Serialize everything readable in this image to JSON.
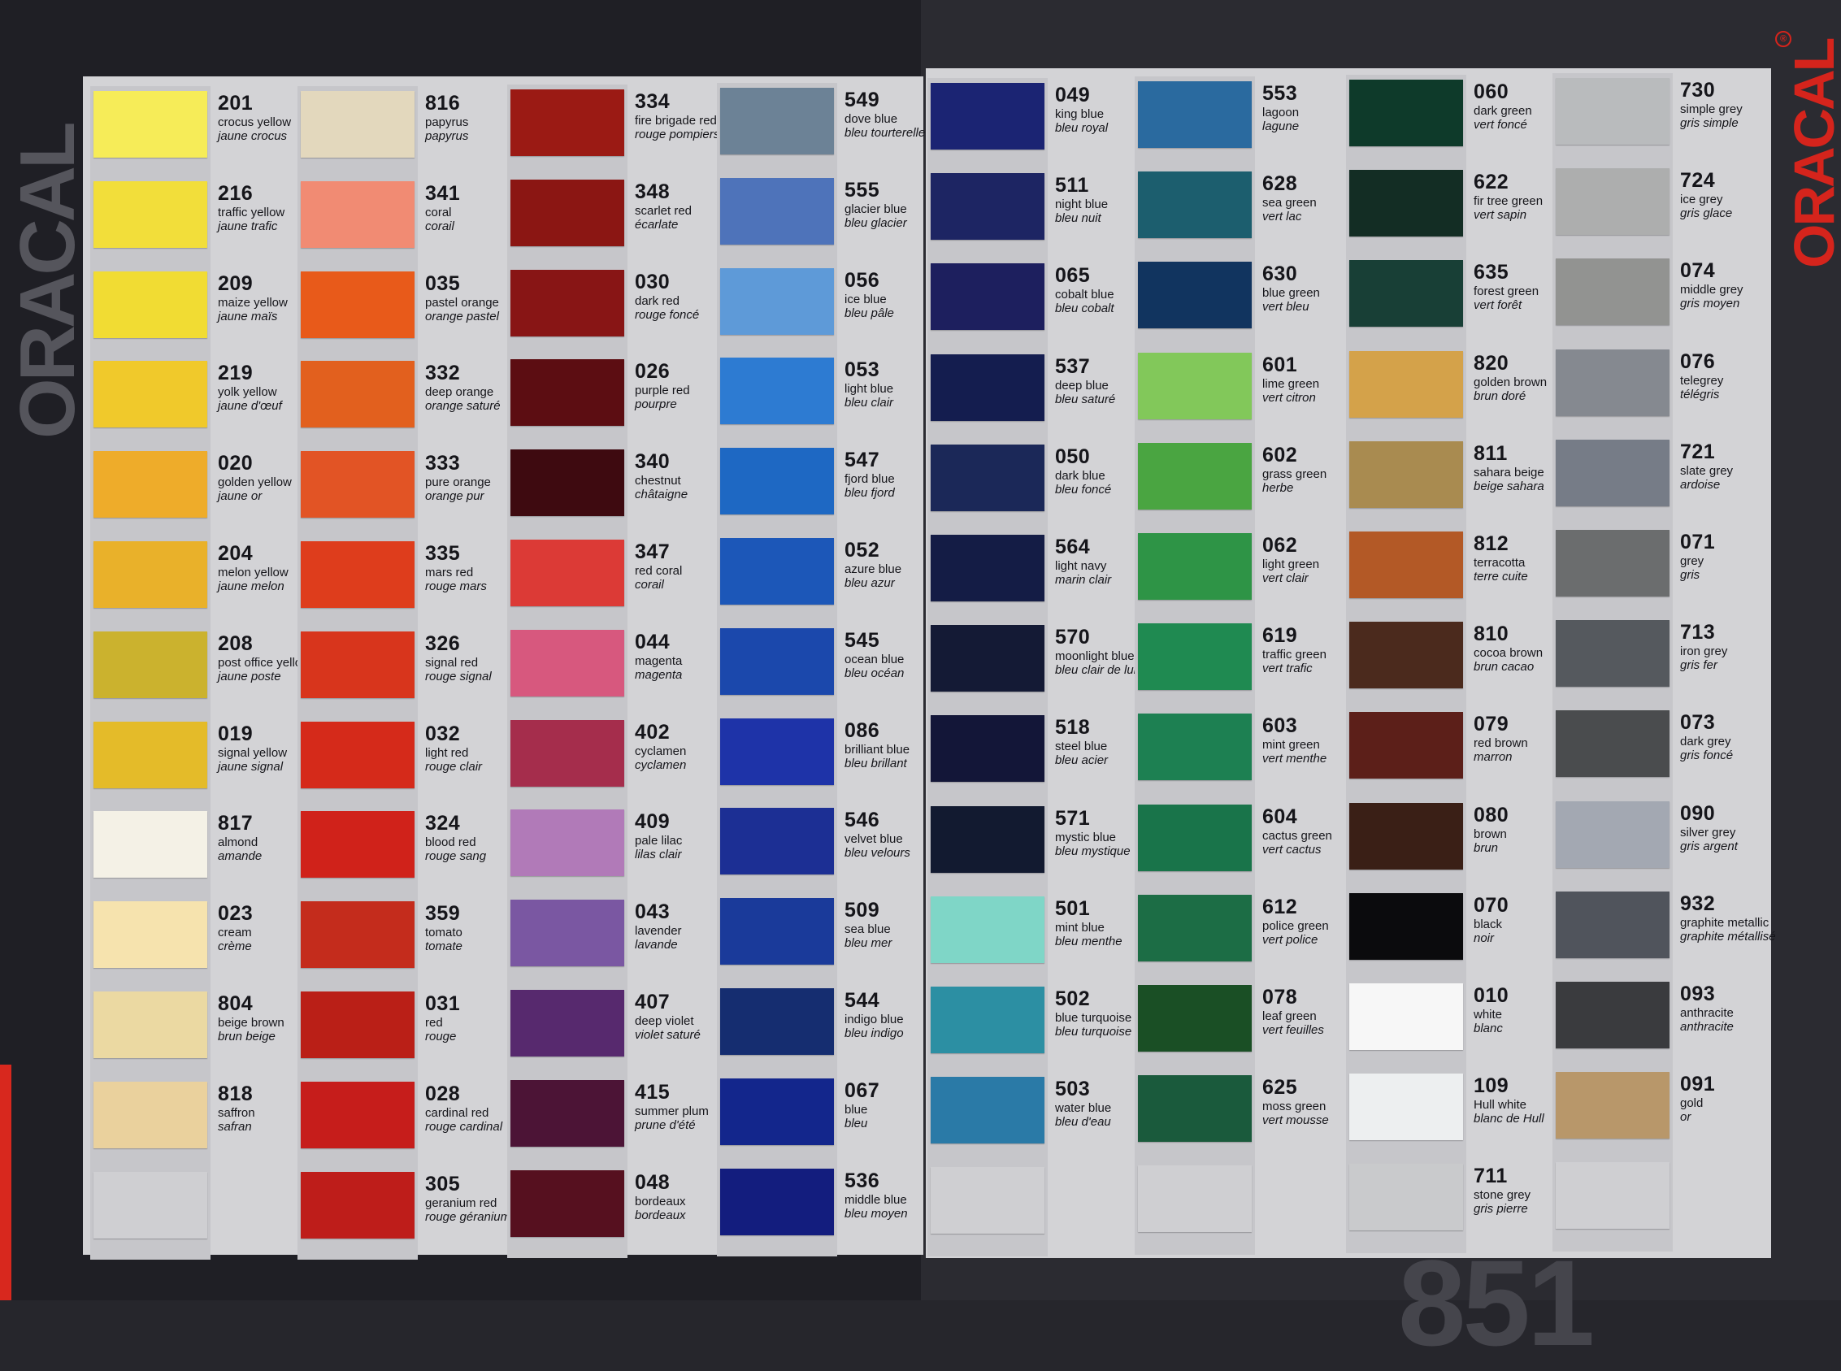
{
  "brand": {
    "left_logo": "ORACAL",
    "right_logo": "ORACAL",
    "registered_mark": "®",
    "series_number": "851"
  },
  "columns": [
    {
      "id": "col1",
      "swatches": [
        {
          "code": "201",
          "name_en": "crocus yellow",
          "name_fr": "jaune crocus",
          "color": "#f6ec58"
        },
        {
          "code": "216",
          "name_en": "traffic yellow",
          "name_fr": "jaune trafic",
          "color": "#f2de3a"
        },
        {
          "code": "209",
          "name_en": "maize yellow",
          "name_fr": "jaune maïs",
          "color": "#f1dc33"
        },
        {
          "code": "219",
          "name_en": "yolk yellow",
          "name_fr": "jaune d'œuf",
          "color": "#f0c92b"
        },
        {
          "code": "020",
          "name_en": "golden yellow",
          "name_fr": "jaune or",
          "color": "#eeac2a"
        },
        {
          "code": "204",
          "name_en": "melon yellow",
          "name_fr": "jaune melon",
          "color": "#e9b12a"
        },
        {
          "code": "208",
          "name_en": "post office yellow",
          "name_fr": "jaune poste",
          "color": "#cbb22e"
        },
        {
          "code": "019",
          "name_en": "signal yellow",
          "name_fr": "jaune signal",
          "color": "#e4bb29"
        },
        {
          "code": "817",
          "name_en": "almond",
          "name_fr": "amande",
          "color": "#f4f1e6"
        },
        {
          "code": "023",
          "name_en": "cream",
          "name_fr": "crème",
          "color": "#f6e3ae"
        },
        {
          "code": "804",
          "name_en": "beige brown",
          "name_fr": "brun beige",
          "color": "#ebd9a2"
        },
        {
          "code": "818",
          "name_en": "saffron",
          "name_fr": "safran",
          "color": "#ead19d"
        }
      ]
    },
    {
      "id": "col2",
      "swatches": [
        {
          "code": "816",
          "name_en": "papyrus",
          "name_fr": "papyrus",
          "color": "#e3d8bd"
        },
        {
          "code": "341",
          "name_en": "coral",
          "name_fr": "corail",
          "color": "#f18b73"
        },
        {
          "code": "035",
          "name_en": "pastel orange",
          "name_fr": "orange pastel",
          "color": "#e85a1a"
        },
        {
          "code": "332",
          "name_en": "deep orange",
          "name_fr": "orange saturé",
          "color": "#e2601e"
        },
        {
          "code": "333",
          "name_en": "pure orange",
          "name_fr": "orange pur",
          "color": "#e25425"
        },
        {
          "code": "335",
          "name_en": "mars red",
          "name_fr": "rouge mars",
          "color": "#de3d1c"
        },
        {
          "code": "326",
          "name_en": "signal red",
          "name_fr": "rouge signal",
          "color": "#d8351c"
        },
        {
          "code": "032",
          "name_en": "light red",
          "name_fr": "rouge clair",
          "color": "#d52a1a"
        },
        {
          "code": "324",
          "name_en": "blood red",
          "name_fr": "rouge sang",
          "color": "#d0221a"
        },
        {
          "code": "359",
          "name_en": "tomato",
          "name_fr": "tomate",
          "color": "#c42c1c"
        },
        {
          "code": "031",
          "name_en": "red",
          "name_fr": "rouge",
          "color": "#ba1f17"
        },
        {
          "code": "028",
          "name_en": "cardinal red",
          "name_fr": "rouge cardinal",
          "color": "#c61d1b"
        },
        {
          "code": "305",
          "name_en": "geranium red",
          "name_fr": "rouge géranium",
          "color": "#be1d1a"
        }
      ]
    },
    {
      "id": "col3",
      "swatches": [
        {
          "code": "334",
          "name_en": "fire brigade red",
          "name_fr": "rouge pompiers",
          "color": "#9b1a14"
        },
        {
          "code": "348",
          "name_en": "scarlet red",
          "name_fr": "écarlate",
          "color": "#8b1613"
        },
        {
          "code": "030",
          "name_en": "dark red",
          "name_fr": "rouge foncé",
          "color": "#881515"
        },
        {
          "code": "026",
          "name_en": "purple red",
          "name_fr": "pourpre",
          "color": "#5c0d12"
        },
        {
          "code": "340",
          "name_en": "chestnut",
          "name_fr": "châtaigne",
          "color": "#3e0a10"
        },
        {
          "code": "347",
          "name_en": "red coral",
          "name_fr": "corail",
          "color": "#dc3a36"
        },
        {
          "code": "044",
          "name_en": "magenta",
          "name_fr": "magenta",
          "color": "#d7587e"
        },
        {
          "code": "402",
          "name_en": "cyclamen",
          "name_fr": "cyclamen",
          "color": "#a52d4c"
        },
        {
          "code": "409",
          "name_en": "pale lilac",
          "name_fr": "lilas clair",
          "color": "#b17ab8"
        },
        {
          "code": "043",
          "name_en": "lavender",
          "name_fr": "lavande",
          "color": "#7a57a2"
        },
        {
          "code": "407",
          "name_en": "deep violet",
          "name_fr": "violet saturé",
          "color": "#57296e"
        },
        {
          "code": "415",
          "name_en": "summer plum",
          "name_fr": "prune d'été",
          "color": "#4c1436"
        },
        {
          "code": "048",
          "name_en": "bordeaux",
          "name_fr": "bordeaux",
          "color": "#56101f"
        }
      ]
    },
    {
      "id": "col4",
      "swatches": [
        {
          "code": "549",
          "name_en": "dove blue",
          "name_fr": "bleu tourterelle",
          "color": "#6c8296"
        },
        {
          "code": "555",
          "name_en": "glacier blue",
          "name_fr": "bleu glacier",
          "color": "#4e73ba"
        },
        {
          "code": "056",
          "name_en": "ice blue",
          "name_fr": "bleu pâle",
          "color": "#5e9ad8"
        },
        {
          "code": "053",
          "name_en": "light blue",
          "name_fr": "bleu clair",
          "color": "#2d7bd2"
        },
        {
          "code": "547",
          "name_en": "fjord blue",
          "name_fr": "bleu fjord",
          "color": "#1e68c3"
        },
        {
          "code": "052",
          "name_en": "azure blue",
          "name_fr": "bleu azur",
          "color": "#1c57b8"
        },
        {
          "code": "545",
          "name_en": "ocean blue",
          "name_fr": "bleu océan",
          "color": "#1b48ac"
        },
        {
          "code": "086",
          "name_en": "brilliant blue",
          "name_fr": "bleu brillant",
          "color": "#1e33a8"
        },
        {
          "code": "546",
          "name_en": "velvet blue",
          "name_fr": "bleu velours",
          "color": "#1c2f94"
        },
        {
          "code": "509",
          "name_en": "sea blue",
          "name_fr": "bleu mer",
          "color": "#1a3a9a"
        },
        {
          "code": "544",
          "name_en": "indigo blue",
          "name_fr": "bleu indigo",
          "color": "#152d70"
        },
        {
          "code": "067",
          "name_en": "blue",
          "name_fr": "bleu",
          "color": "#13268c"
        },
        {
          "code": "536",
          "name_en": "middle blue",
          "name_fr": "bleu moyen",
          "color": "#131d7e"
        }
      ]
    },
    {
      "id": "col5",
      "swatches": [
        {
          "code": "049",
          "name_en": "king blue",
          "name_fr": "bleu royal",
          "color": "#1b2473"
        },
        {
          "code": "511",
          "name_en": "night blue",
          "name_fr": "bleu nuit",
          "color": "#1d2563"
        },
        {
          "code": "065",
          "name_en": "cobalt blue",
          "name_fr": "bleu cobalt",
          "color": "#1d1f5e"
        },
        {
          "code": "537",
          "name_en": "deep blue",
          "name_fr": "bleu saturé",
          "color": "#141d4f"
        },
        {
          "code": "050",
          "name_en": "dark blue",
          "name_fr": "bleu foncé",
          "color": "#1b2858"
        },
        {
          "code": "564",
          "name_en": "light navy",
          "name_fr": "marin clair",
          "color": "#141c45"
        },
        {
          "code": "570",
          "name_en": "moonlight blue",
          "name_fr": "bleu clair de lune",
          "color": "#141a35"
        },
        {
          "code": "518",
          "name_en": "steel blue",
          "name_fr": "bleu acier",
          "color": "#131638"
        },
        {
          "code": "571",
          "name_en": "mystic blue",
          "name_fr": "bleu mystique",
          "color": "#121a30"
        },
        {
          "code": "501",
          "name_en": "mint blue",
          "name_fr": "bleu menthe",
          "color": "#7fd6c7"
        },
        {
          "code": "502",
          "name_en": "blue turquoise",
          "name_fr": "bleu turquoise",
          "color": "#2c8fa3"
        },
        {
          "code": "503",
          "name_en": "water blue",
          "name_fr": "bleu d'eau",
          "color": "#2a7aa7"
        }
      ]
    },
    {
      "id": "col6",
      "swatches": [
        {
          "code": "553",
          "name_en": "lagoon",
          "name_fr": "lagune",
          "color": "#2a6a9f"
        },
        {
          "code": "628",
          "name_en": "sea green",
          "name_fr": "vert lac",
          "color": "#1c5e6e"
        },
        {
          "code": "630",
          "name_en": "blue green",
          "name_fr": "vert bleu",
          "color": "#11345f"
        },
        {
          "code": "601",
          "name_en": "lime green",
          "name_fr": "vert citron",
          "color": "#82c85a"
        },
        {
          "code": "602",
          "name_en": "grass green",
          "name_fr": "herbe",
          "color": "#4aa541"
        },
        {
          "code": "062",
          "name_en": "light green",
          "name_fr": "vert clair",
          "color": "#2e9446"
        },
        {
          "code": "619",
          "name_en": "traffic green",
          "name_fr": "vert trafic",
          "color": "#1f8a51"
        },
        {
          "code": "603",
          "name_en": "mint green",
          "name_fr": "vert menthe",
          "color": "#1d8052"
        },
        {
          "code": "604",
          "name_en": "cactus green",
          "name_fr": "vert cactus",
          "color": "#19744a"
        },
        {
          "code": "612",
          "name_en": "police green",
          "name_fr": "vert police",
          "color": "#1c6d45"
        },
        {
          "code": "078",
          "name_en": "leaf green",
          "name_fr": "vert feuilles",
          "color": "#1a4f25"
        },
        {
          "code": "625",
          "name_en": "moss green",
          "name_fr": "vert mousse",
          "color": "#1a5a3c"
        }
      ]
    },
    {
      "id": "col7",
      "swatches": [
        {
          "code": "060",
          "name_en": "dark green",
          "name_fr": "vert foncé",
          "color": "#0e3a2a"
        },
        {
          "code": "622",
          "name_en": "fir tree green",
          "name_fr": "vert sapin",
          "color": "#132d24"
        },
        {
          "code": "635",
          "name_en": "forest green",
          "name_fr": "vert forêt",
          "color": "#183f36"
        },
        {
          "code": "820",
          "name_en": "golden brown",
          "name_fr": "brun doré",
          "color": "#d4a24a"
        },
        {
          "code": "811",
          "name_en": "sahara beige",
          "name_fr": "beige sahara",
          "color": "#a98b50"
        },
        {
          "code": "812",
          "name_en": "terracotta",
          "name_fr": "terre cuite",
          "color": "#b35926"
        },
        {
          "code": "810",
          "name_en": "cocoa brown",
          "name_fr": "brun cacao",
          "color": "#4b2a1d"
        },
        {
          "code": "079",
          "name_en": "red brown",
          "name_fr": "marron",
          "color": "#5c1f19"
        },
        {
          "code": "080",
          "name_en": "brown",
          "name_fr": "brun",
          "color": "#3a1f16"
        },
        {
          "code": "070",
          "name_en": "black",
          "name_fr": "noir",
          "color": "#0b0b0d"
        },
        {
          "code": "010",
          "name_en": "white",
          "name_fr": "blanc",
          "color": "#f7f7f7"
        },
        {
          "code": "109",
          "name_en": "Hull white",
          "name_fr": "blanc de Hull",
          "color": "#edeff0"
        },
        {
          "code": "711",
          "name_en": "stone grey",
          "name_fr": "gris pierre",
          "color": "#c9cacc"
        }
      ]
    },
    {
      "id": "col8",
      "swatches": [
        {
          "code": "730",
          "name_en": "simple grey",
          "name_fr": "gris simple",
          "color": "#b9bbbd"
        },
        {
          "code": "724",
          "name_en": "ice grey",
          "name_fr": "gris glace",
          "color": "#adaeae"
        },
        {
          "code": "074",
          "name_en": "middle grey",
          "name_fr": "gris moyen",
          "color": "#929391"
        },
        {
          "code": "076",
          "name_en": "telegrey",
          "name_fr": "télégris",
          "color": "#858990"
        },
        {
          "code": "721",
          "name_en": "slate grey",
          "name_fr": "ardoise",
          "color": "#767c87"
        },
        {
          "code": "071",
          "name_en": "grey",
          "name_fr": "gris",
          "color": "#6b6d6e"
        },
        {
          "code": "713",
          "name_en": "iron grey",
          "name_fr": "gris fer",
          "color": "#55595e"
        },
        {
          "code": "073",
          "name_en": "dark grey",
          "name_fr": "gris foncé",
          "color": "#4a4c4e"
        },
        {
          "code": "090",
          "name_en": "silver grey",
          "name_fr": "gris argent",
          "color": "#a3a8b2"
        },
        {
          "code": "932",
          "name_en": "graphite metallic",
          "name_fr": "graphite métallisé",
          "color": "#50545c"
        },
        {
          "code": "093",
          "name_en": "anthracite",
          "name_fr": "anthracite",
          "color": "#3a3b3e"
        },
        {
          "code": "091",
          "name_en": "gold",
          "name_fr": "or",
          "color": "#b8976a"
        }
      ]
    }
  ]
}
